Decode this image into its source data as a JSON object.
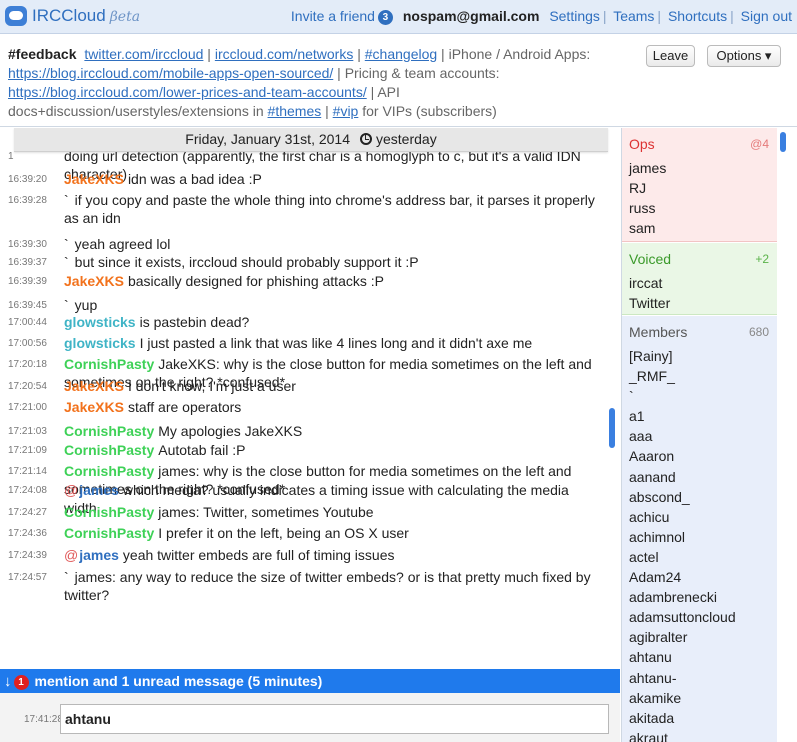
{
  "app": {
    "name": "IRCCloud",
    "beta": "βeta"
  },
  "nav": {
    "invite": "Invite a friend",
    "invite_count": "3",
    "email": "nospam@gmail.com",
    "settings": "Settings",
    "teams": "Teams",
    "shortcuts": "Shortcuts",
    "signout": "Sign out"
  },
  "topic": {
    "channel": "#feedback",
    "link1": "twitter.com/irccloud",
    "sep1": " | ",
    "link2": "irccloud.com/networks",
    "sep2": " | ",
    "link3": "#changelog",
    "text1": " | iPhone / Android Apps: ",
    "link4": "https://blog.irccloud.com/mobile-apps-open-sourced/",
    "text2": " | Pricing & team accounts: ",
    "link5": "https://blog.irccloud.com/lower-prices-and-team-accounts/",
    "text3": " | API docs+discussion/userstyles/extensions in ",
    "link6": "#themes",
    "sep3": " | ",
    "link7": "#vip",
    "text4": " for VIPs (subscribers)"
  },
  "buttons": {
    "leave": "Leave",
    "options": "Options ▾"
  },
  "datebar": {
    "date": "Friday, January 31st, 2014",
    "relative": "yesterday"
  },
  "messages": [
    {
      "ts": "1",
      "nick": "",
      "prefix": "",
      "text": "doing url detection (apparently, the first char is a homoglyph to c, but it's a valid IDN character)"
    },
    {
      "ts": "16:39:20",
      "nick": "JakeXKS",
      "prefix": "",
      "text": "idn was a bad idea :P"
    },
    {
      "ts": "16:39:28",
      "nick": "",
      "prefix": "`",
      "text": "if you copy and paste the whole thing into chrome's address bar, it parses it properly as an idn"
    },
    {
      "ts": "16:39:30",
      "nick": "",
      "prefix": "`",
      "text": "yeah agreed lol"
    },
    {
      "ts": "16:39:37",
      "nick": "",
      "prefix": "`",
      "text": "but since it exists, irccloud should probably support it :P"
    },
    {
      "ts": "16:39:39",
      "nick": "JakeXKS",
      "prefix": "",
      "text": "basically designed for phishing attacks :P"
    },
    {
      "ts": "16:39:45",
      "nick": "",
      "prefix": "`",
      "text": "yup"
    },
    {
      "ts": "17:00:44",
      "nick": "glowsticks",
      "prefix": "",
      "text": "is pastebin dead?"
    },
    {
      "ts": "17:00:56",
      "nick": "glowsticks",
      "prefix": "",
      "text": "I just pasted a link that was like 4 lines long and it didn't axe me"
    },
    {
      "ts": "17:20:18",
      "nick": "CornishPasty",
      "prefix": "",
      "text": "JakeXKS: why is the close button for media sometimes on the left and sometimes on the right? *confused*"
    },
    {
      "ts": "17:20:54",
      "nick": "JakeXKS",
      "prefix": "",
      "text": "I don't know, I'm just a user"
    },
    {
      "ts": "17:21:00",
      "nick": "JakeXKS",
      "prefix": "",
      "text": "staff are operators"
    },
    {
      "ts": "17:21:03",
      "nick": "CornishPasty",
      "prefix": "",
      "text": "My apologies JakeXKS"
    },
    {
      "ts": "17:21:09",
      "nick": "CornishPasty",
      "prefix": "",
      "text": "Autotab fail :P"
    },
    {
      "ts": "17:21:14",
      "nick": "CornishPasty",
      "prefix": "",
      "text": "james: why is the close button for media sometimes on the left and sometimes on the right? *confused*"
    },
    {
      "ts": "17:24:08",
      "nick": "james",
      "prefix": "@",
      "text": "which media? usually indicates a timing issue with calculating the media width"
    },
    {
      "ts": "17:24:27",
      "nick": "CornishPasty",
      "prefix": "",
      "text": "james: Twitter, sometimes Youtube"
    },
    {
      "ts": "17:24:36",
      "nick": "CornishPasty",
      "prefix": "",
      "text": "I prefer it on the left, being an OS X user"
    },
    {
      "ts": "17:24:39",
      "nick": "james",
      "prefix": "@",
      "text": "yeah twitter embeds are full of timing issues"
    },
    {
      "ts": "17:24:57",
      "nick": "",
      "prefix": "`",
      "text": "james: any way to reduce the size of twitter embeds? or is that pretty much fixed by twitter?"
    }
  ],
  "unread": {
    "count": "1",
    "text": "mention and 1 unread message (5 minutes)"
  },
  "input": {
    "ts": "17:41:28",
    "value": "ahtanu"
  },
  "sidebar": {
    "ops": {
      "title": "Ops",
      "count": "@4",
      "items": [
        "james",
        "RJ",
        "russ",
        "sam"
      ]
    },
    "voiced": {
      "title": "Voiced",
      "count": "+2",
      "items": [
        "irccat",
        "Twitter"
      ]
    },
    "members": {
      "title": "Members",
      "count": "680",
      "items": [
        "[Rainy]",
        "_RMF_",
        "`",
        "a1",
        "aaa",
        "Aaaron",
        "aanand",
        "abscond_",
        "achicu",
        "achimnol",
        "actel",
        "Adam24",
        "adambrenecki",
        "adamsuttoncloud",
        "agibralter",
        "ahtanu",
        "ahtanu-",
        "akamike",
        "akitada",
        "akraut"
      ]
    }
  },
  "colors": {
    "accent": "#1f7aec",
    "ops_bg": "#fdeaea",
    "voiced_bg": "#eaf7e6",
    "members_bg": "#e8eefa"
  }
}
